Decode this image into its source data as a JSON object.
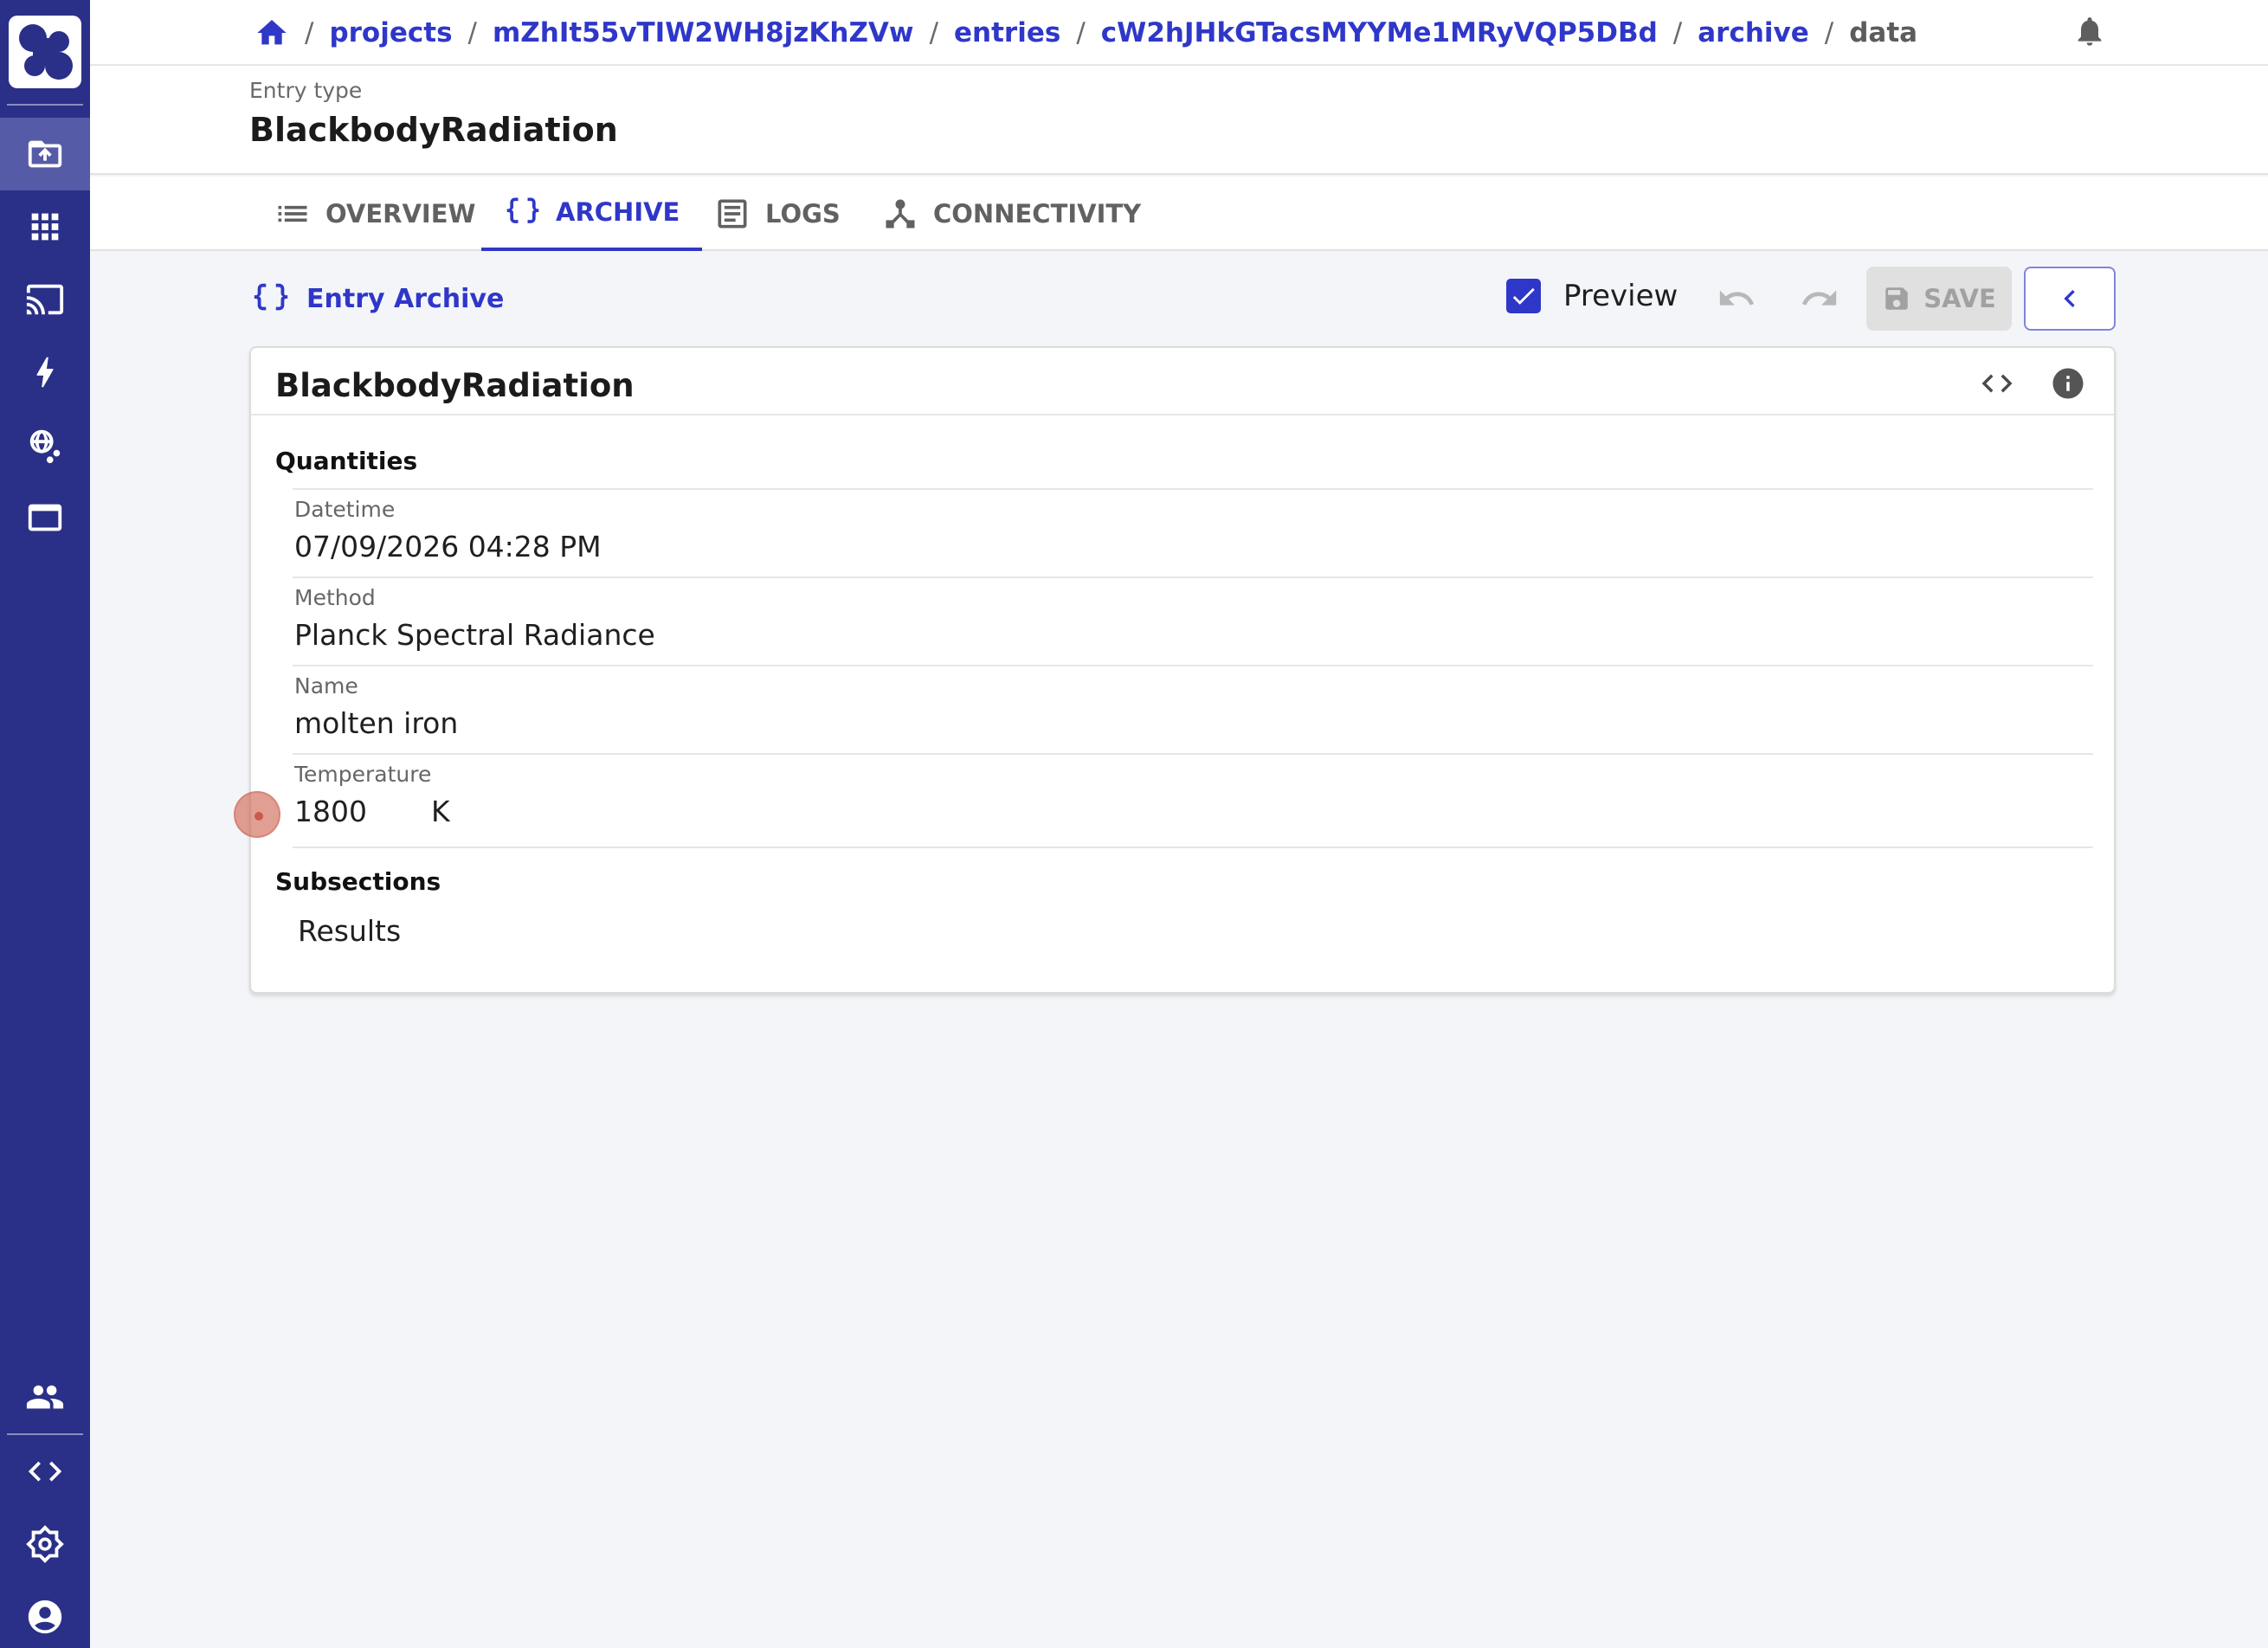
{
  "breadcrumb": {
    "items": [
      "projects",
      "mZhIt55vTIW2WH8jzKhZVw",
      "entries",
      "cW2hJHkGTacsMYYMe1MRyVQP5DBd",
      "archive",
      "data"
    ],
    "separator": "/"
  },
  "sidebar": {
    "icons": [
      "uploads-icon",
      "apps-icon",
      "cast-icon",
      "bolt-icon",
      "network-icon",
      "window-icon",
      "groups-icon",
      "code-icon",
      "settings-icon",
      "account-icon"
    ],
    "active": "uploads-icon"
  },
  "header": {
    "entry_type_label": "Entry type",
    "entry_type_value": "BlackbodyRadiation"
  },
  "tabs": [
    {
      "label": "OVERVIEW",
      "icon": "list-icon"
    },
    {
      "label": "ARCHIVE",
      "icon": "braces-icon",
      "active": true
    },
    {
      "label": "LOGS",
      "icon": "log-icon"
    },
    {
      "label": "CONNECTIVITY",
      "icon": "connectivity-icon"
    }
  ],
  "toolbar": {
    "title": "Entry Archive",
    "preview_label": "Preview",
    "preview_checked": true,
    "save_label": "SAVE"
  },
  "card": {
    "title": "BlackbodyRadiation",
    "quantities_heading": "Quantities",
    "fields": [
      {
        "label": "Datetime",
        "value": "07/09/2026 04:28 PM"
      },
      {
        "label": "Method",
        "value": "Planck Spectral Radiance"
      },
      {
        "label": "Name",
        "value": "molten iron"
      },
      {
        "label": "Temperature",
        "value": "1800",
        "unit": "K"
      }
    ],
    "subsections_heading": "Subsections",
    "subsections": [
      "Results"
    ]
  },
  "colors": {
    "sidebar": "#2a3087",
    "accent": "#2f37c9",
    "background": "#f4f5f9"
  }
}
